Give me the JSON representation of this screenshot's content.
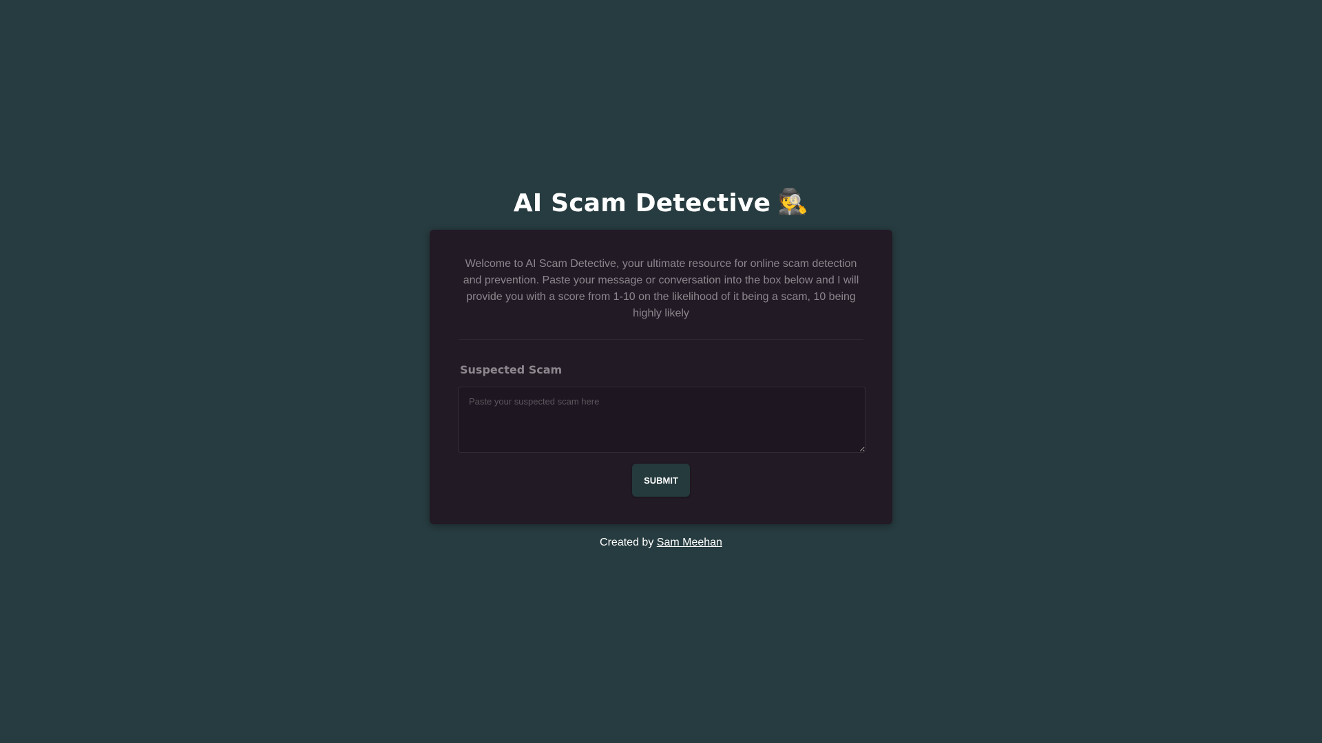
{
  "header": {
    "title": "AI Scam Detective",
    "title_emoji": "🕵️"
  },
  "card": {
    "intro": "Welcome to AI Scam Detective, your ultimate resource for online scam detection and prevention. Paste your message or conversation into the box below and I will provide you with a score from 1-10 on the likelihood of it being a scam, 10 being highly likely",
    "field_label": "Suspected Scam",
    "input_value": "",
    "input_placeholder": "Paste your suspected scam here",
    "submit_label": "SUBMIT"
  },
  "footer": {
    "prefix": "Created by",
    "author_link": "Sam Meehan"
  },
  "colors": {
    "page_background": "#273c40",
    "card_background": "#221a25",
    "button_background": "#243a3d",
    "muted_text": "#8d868d"
  }
}
